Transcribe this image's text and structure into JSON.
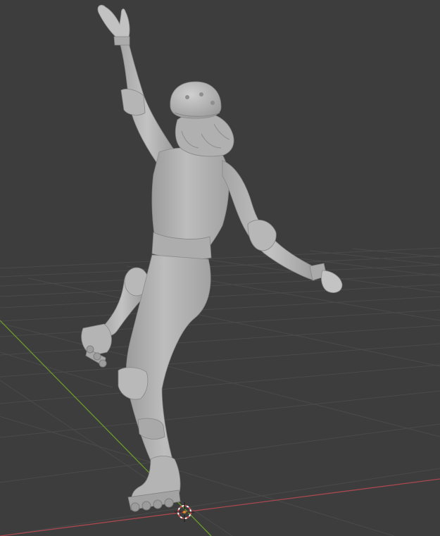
{
  "viewport": {
    "background_color": "#3d3d3d",
    "grid_color": "#4a4a4a",
    "x_axis_color": "#a8484f",
    "y_axis_color": "#6c9a2c",
    "model_color": "#b3b3b3",
    "model_shadow_color": "#8e8e8e",
    "model_highlight_color": "#c8c8c8",
    "cursor_icon": "3d-cursor-icon",
    "object": "posed-roller-skater-sculpt"
  }
}
